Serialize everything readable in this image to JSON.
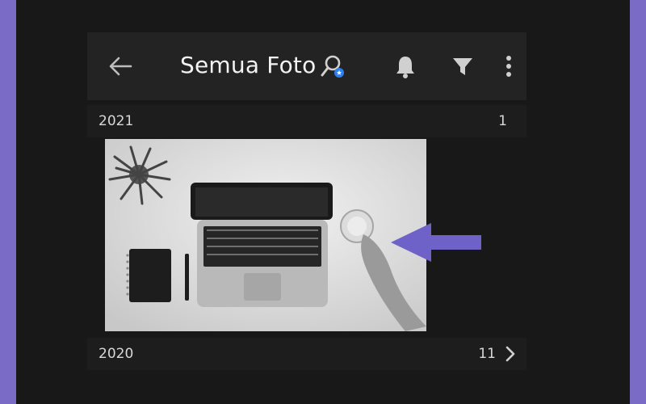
{
  "header": {
    "title": "Semua Foto",
    "back_icon": "arrow-left-icon",
    "search_icon": "people-search-icon",
    "notification_icon": "bell-icon",
    "filter_icon": "filter-icon",
    "more_icon": "vertical-dots-icon"
  },
  "groups": [
    {
      "year": "2021",
      "count": "1"
    },
    {
      "year": "2020",
      "count": "11"
    }
  ],
  "colors": {
    "background": "#181818",
    "header": "#232323",
    "accent": "#6e62c8",
    "badge": "#2f80ed"
  }
}
